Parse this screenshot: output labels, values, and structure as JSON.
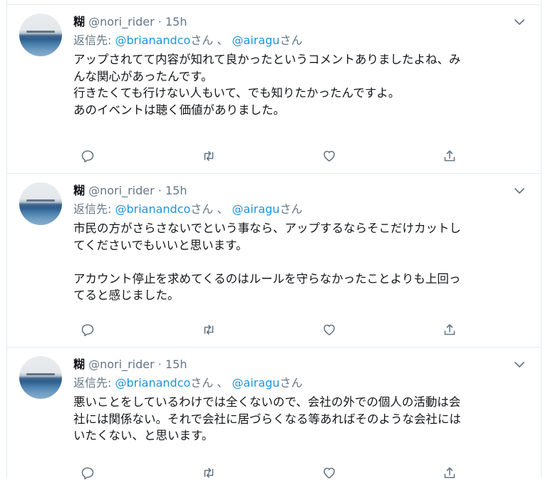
{
  "tweets": [
    {
      "name": "糊",
      "handle": "@nori_rider",
      "separator": "·",
      "time": "15h",
      "reply_prefix": "返信先: ",
      "mentions": [
        {
          "handle": "@brianandco",
          "suffix": "さん"
        },
        {
          "handle": "@airagu",
          "suffix": "さん"
        }
      ],
      "mention_separator": " 、 ",
      "lines": [
        "アップされてて内容が知れて良かったというコメントありましたよね、み",
        "んな関心があったんです。",
        "行きたくても行けない人もいて、でも知りたかったんですよ。",
        "あのイベントは聴く価値がありました。"
      ]
    },
    {
      "name": "糊",
      "handle": "@nori_rider",
      "separator": "·",
      "time": "15h",
      "reply_prefix": "返信先: ",
      "mentions": [
        {
          "handle": "@brianandco",
          "suffix": "さん"
        },
        {
          "handle": "@airagu",
          "suffix": "さん"
        }
      ],
      "mention_separator": " 、 ",
      "lines": [
        "市民の方がさらさないでという事なら、アップするならそこだけカットし",
        "てくださいでもいいと思います。",
        "",
        "アカウント停止を求めてくるのはルールを守らなかったことよりも上回っ",
        "てると感じました。"
      ]
    },
    {
      "name": "糊",
      "handle": "@nori_rider",
      "separator": "·",
      "time": "15h",
      "reply_prefix": "返信先: ",
      "mentions": [
        {
          "handle": "@brianandco",
          "suffix": "さん"
        },
        {
          "handle": "@airagu",
          "suffix": "さん"
        }
      ],
      "mention_separator": " 、 ",
      "lines": [
        "悪いことをしているわけでは全くないので、会社の外での個人の活動は会",
        "社には関係ない。それで会社に居づらくなる等あればそのような会社には",
        "いたくない、と思います。"
      ]
    }
  ],
  "icons": {
    "menu": "chevron-down-icon",
    "reply": "reply-icon",
    "retweet": "retweet-icon",
    "like": "like-icon",
    "share": "share-icon"
  },
  "colors": {
    "text": "#14171a",
    "secondary": "#657786",
    "link": "#1b95e0",
    "icon": "#657786",
    "border": "#e6ecf0"
  }
}
